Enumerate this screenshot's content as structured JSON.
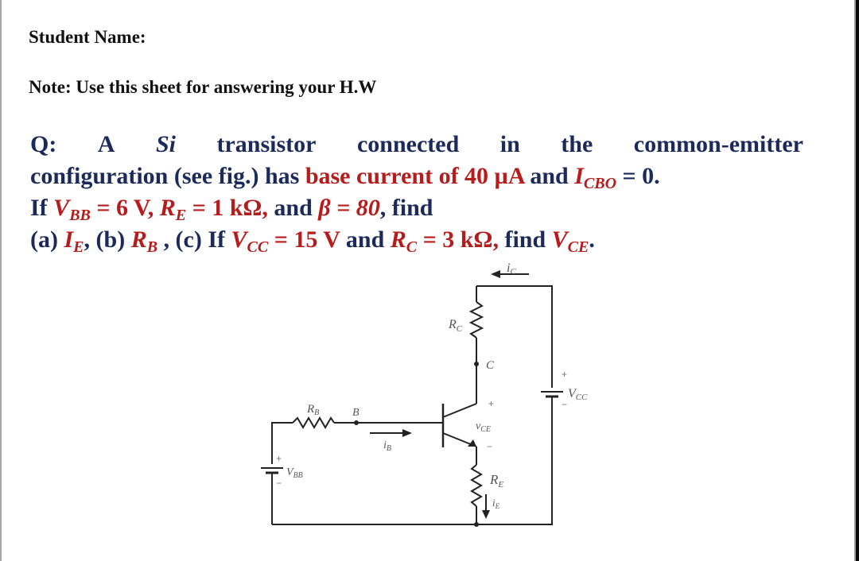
{
  "header": {
    "student_name_label": "Student Name:",
    "note": "Note: Use this sheet for answering your H.W"
  },
  "question": {
    "line1": [
      "Q:",
      "A",
      "Si",
      "transistor",
      "connected",
      "in",
      "the",
      "common-emitter"
    ],
    "line2": {
      "prefix": "configuration (see fig.) has ",
      "highlight": "base current of 40 µA",
      "mid": " and ",
      "icbo_var": "I",
      "icbo_sub": "CBO",
      "suffix": " = 0."
    },
    "line3": {
      "prefix": "If ",
      "vbb_var": "V",
      "vbb_sub": "BB",
      "vbb_val": " = 6 V, ",
      "re_var": "R",
      "re_sub": "E",
      "re_val": " = 1 kΩ,",
      "mid": " and ",
      "beta": "β = 80",
      "suffix": ", find"
    },
    "line4": {
      "part_a": "(a) ",
      "ie_var": "I",
      "ie_sub": "E",
      "part_b": ", (b) ",
      "rb_var": "R",
      "rb_sub": "B",
      "part_c": " , (c) If ",
      "vcc_var": "V",
      "vcc_sub": "CC",
      "vcc_val": " = 15 V",
      "and": " and ",
      "rc_var": "R",
      "rc_sub": "C",
      "rc_val": " = 3 kΩ,",
      "find": " find ",
      "vce_var": "V",
      "vce_sub": "CE",
      "end": "."
    }
  },
  "circuit": {
    "labels": {
      "ic": "i",
      "ic_sub": "C",
      "rc": "R",
      "rc_sub": "C",
      "c_node": "C",
      "vcc": "V",
      "vcc_sub": "CC",
      "rb": "R",
      "rb_sub": "B",
      "b_node": "B",
      "ib": "i",
      "ib_sub": "B",
      "vce": "v",
      "vce_sub": "CE",
      "vbb": "V",
      "vbb_sub": "BB",
      "re": "R",
      "re_sub": "E",
      "ie": "i",
      "ie_sub": "E",
      "plus": "+",
      "minus": "−"
    }
  },
  "colors": {
    "text_primary": "#1b2a5a",
    "text_highlight": "#b71c1c",
    "circuit_wire": "#222222"
  }
}
